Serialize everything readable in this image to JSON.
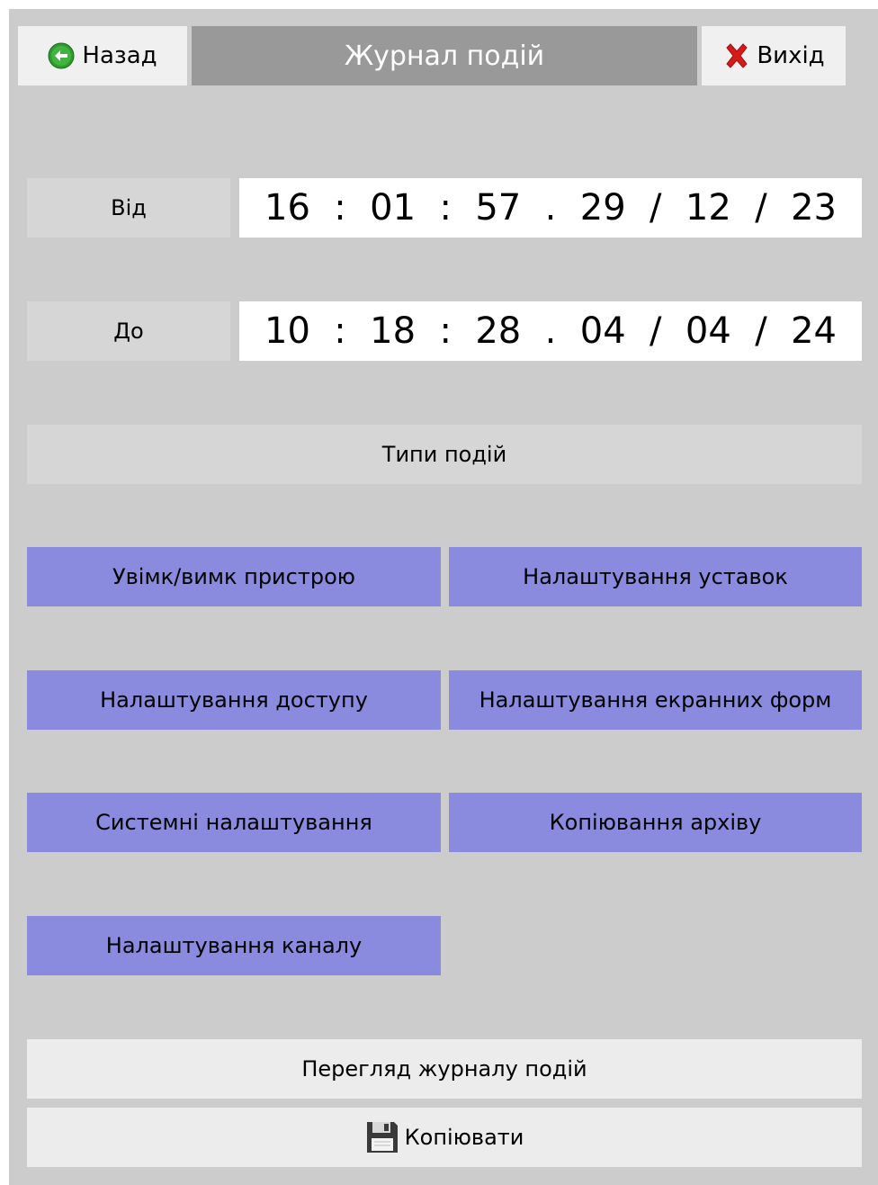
{
  "header": {
    "back_label": "Назад",
    "title": "Журнал подій",
    "exit_label": "Вихід"
  },
  "range": {
    "from_label": "Від",
    "from": {
      "hh": "16",
      "mm": "01",
      "ss": "57",
      "dd": "29",
      "mo": "12",
      "yy": "23"
    },
    "to_label": "До",
    "to": {
      "hh": "10",
      "mm": "18",
      "ss": "28",
      "dd": "04",
      "mo": "04",
      "yy": "24"
    },
    "sep_time": ":",
    "sep_dot": ".",
    "sep_date": "/"
  },
  "event_types": {
    "header": "Типи подій",
    "buttons": [
      "Увімк/вимк пристрою",
      "Налаштування уставок",
      "Налаштування доступу",
      "Налаштування екранних форм",
      "Системні налаштування",
      "Копіювання архіву",
      "Налаштування каналу"
    ]
  },
  "actions": {
    "view_label": "Перегляд журналу подій",
    "copy_label": "Копіювати"
  },
  "icons": {
    "back": "arrow-left-circle-icon",
    "exit": "red-x-icon",
    "copy": "floppy-disk-icon"
  },
  "colors": {
    "background": "#cccccc",
    "title_bar": "#999999",
    "event_button": "#8a8adf",
    "back_icon": "#2e9b2e",
    "exit_icon": "#d61a1a"
  }
}
